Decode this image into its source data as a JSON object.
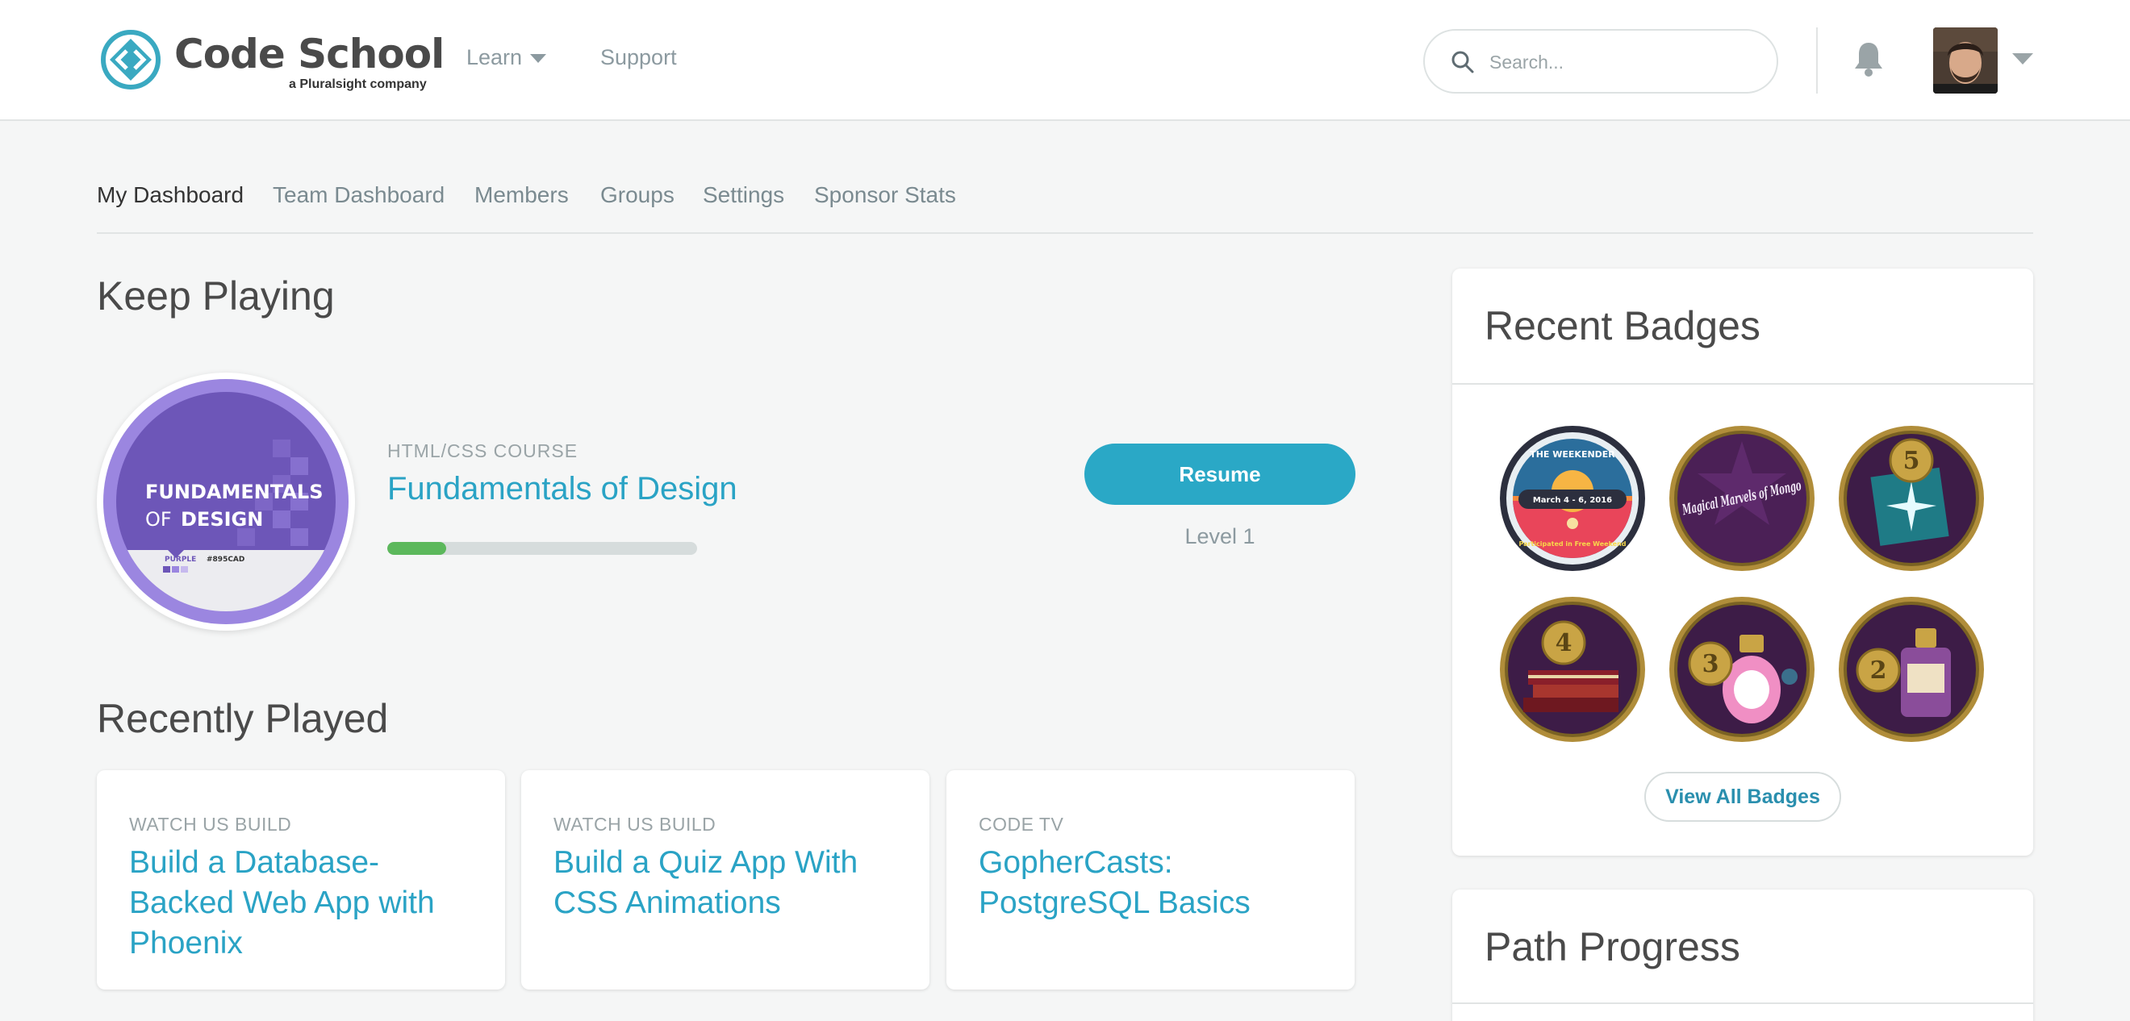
{
  "header": {
    "logo_text": "Code School",
    "logo_subtitle": "a Pluralsight company",
    "nav": [
      {
        "label": "Learn",
        "has_dropdown": true
      },
      {
        "label": "Support"
      }
    ],
    "search_placeholder": "Search...",
    "icons": [
      "search-icon",
      "bell-icon",
      "avatar",
      "chevron-down-icon"
    ]
  },
  "subnav": {
    "items": [
      {
        "label": "My Dashboard",
        "active": true
      },
      {
        "label": "Team Dashboard"
      },
      {
        "label": "Members"
      },
      {
        "label": "Groups"
      },
      {
        "label": "Settings"
      },
      {
        "label": "Sponsor Stats"
      }
    ]
  },
  "keep_playing": {
    "heading": "Keep Playing",
    "course": {
      "badge_line1": "FUNDAMENTALS",
      "badge_line2_a": "OF",
      "badge_line2_b": "DESIGN",
      "badge_swatch_label": "PURPLE",
      "badge_swatch_hex": "#895CAD",
      "category": "HTML/CSS COURSE",
      "title": "Fundamentals of Design",
      "progress_fraction": 0.19,
      "resume_label": "Resume",
      "level_label": "Level 1"
    }
  },
  "recently_played": {
    "heading": "Recently Played",
    "cards": [
      {
        "category": "WATCH US BUILD",
        "title": "Build a Database-Backed Web App with Phoenix"
      },
      {
        "category": "WATCH US BUILD",
        "title": "Build a Quiz App With CSS Animations"
      },
      {
        "category": "CODE TV",
        "title": "GopherCasts: PostgreSQL Basics"
      }
    ]
  },
  "recent_badges": {
    "heading": "Recent Badges",
    "badges": [
      {
        "name": "the-weekender-badge",
        "ribbon_text": "THE WEEKENDER",
        "date_text": "March 4 - 6, 2016",
        "bottom_text": "Participated in Free Weekend"
      },
      {
        "name": "magical-marvels-of-mongo-badge",
        "text": "Magical Marvels of Mongo"
      },
      {
        "name": "level-5-badge",
        "number": "5"
      },
      {
        "name": "level-4-badge",
        "number": "4"
      },
      {
        "name": "level-3-badge",
        "number": "3"
      },
      {
        "name": "level-2-badge",
        "number": "2"
      }
    ],
    "view_all_label": "View All Badges"
  },
  "path_progress": {
    "heading": "Path Progress"
  },
  "colors": {
    "accent": "#2aa8c6",
    "link": "#2aa3c5",
    "progress": "#5cb85c",
    "course_purple": "#7b61c4"
  }
}
